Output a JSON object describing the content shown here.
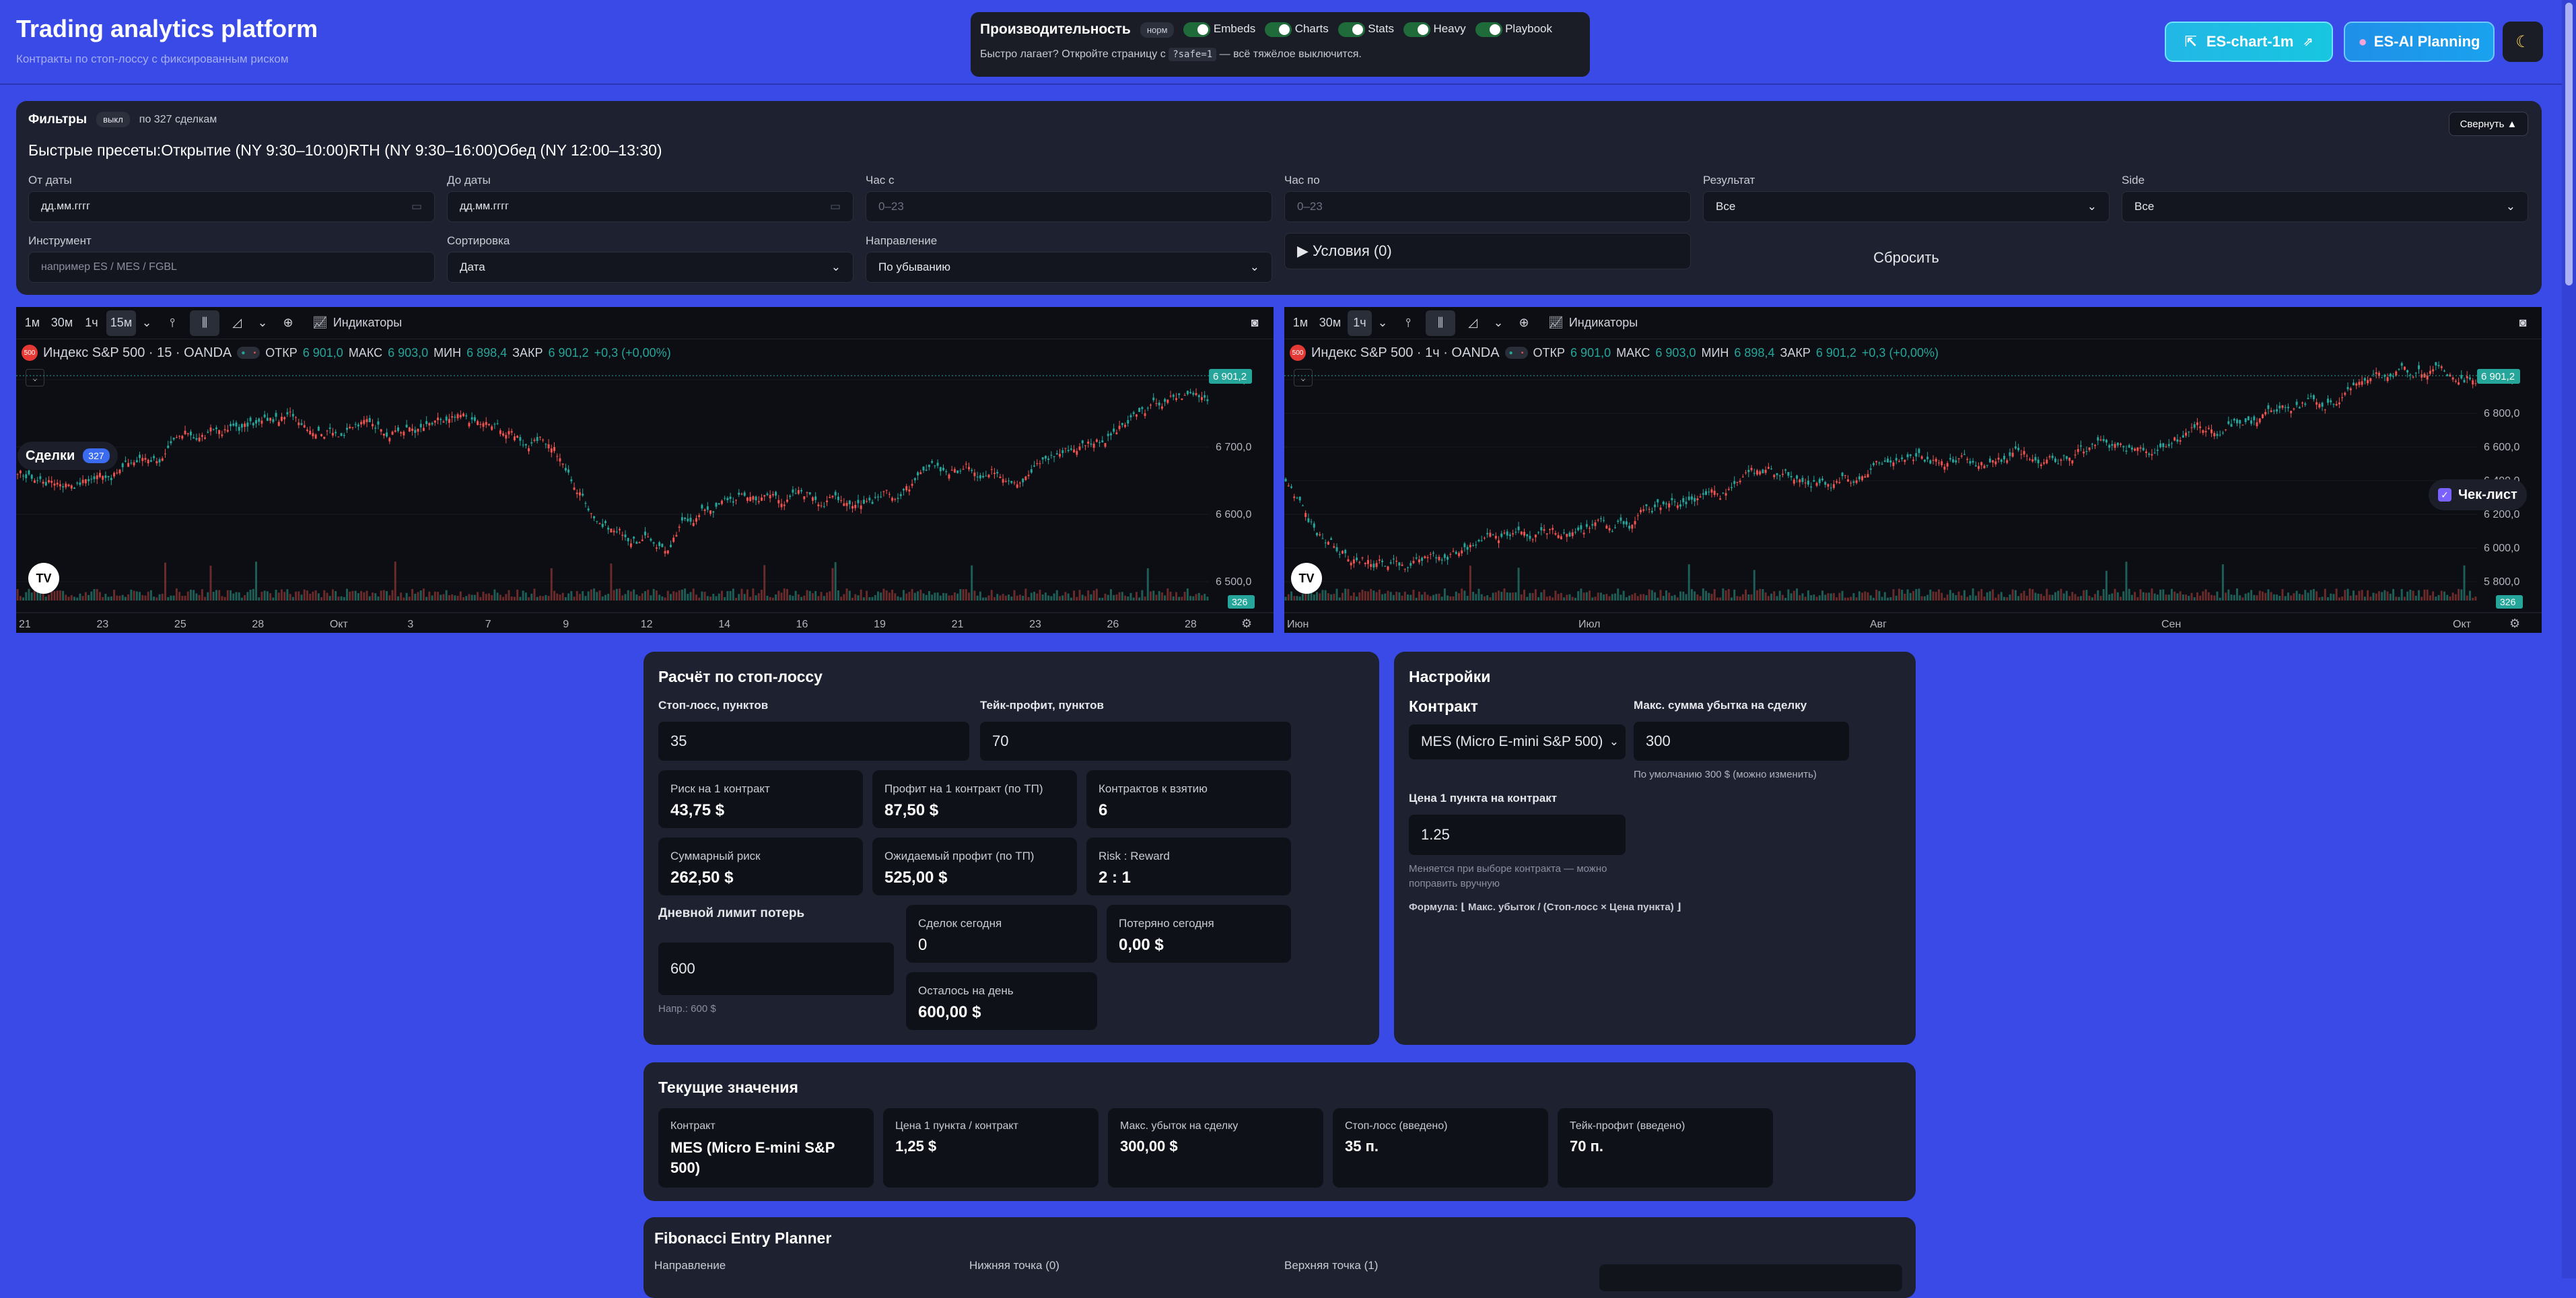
{
  "header": {
    "title": "Trading analytics platform",
    "subtitle": "Контракты по стоп-лоссу с фиксированным риском"
  },
  "perf": {
    "title": "Производительность",
    "mode_badge": "норм",
    "toggles": [
      "Embeds",
      "Charts",
      "Stats",
      "Heavy",
      "Playbook"
    ],
    "hint_pre": "Быстро лагает? Откройте страницу с",
    "hint_code": "?safe=1",
    "hint_post": "— всё тяжёлое выключится."
  },
  "top_buttons": {
    "chart": "ES-chart-1m",
    "planning": "ES-AI Planning",
    "theme_icon": "moon-icon"
  },
  "filters": {
    "title": "Фильтры",
    "badge": "выкл",
    "count": "по 327 сделкам",
    "collapse": "Свернуть ▲",
    "presets_label": "Быстрые пресеты:",
    "presets": [
      "Открытие (NY 9:30–10:00)",
      "RTH (NY 9:30–16:00)",
      "Обед (NY 12:00–13:30)"
    ],
    "from_label": "От даты",
    "from_value": "дд.мм.гггг",
    "to_label": "До даты",
    "to_value": "дд.мм.гггг",
    "hour_from_label": "Час с",
    "hour_from_placeholder": "0–23",
    "hour_to_label": "Час по",
    "hour_to_placeholder": "0–23",
    "result_label": "Результат",
    "result_value": "Все",
    "side_label": "Side",
    "side_value": "Все",
    "instrument_label": "Инструмент",
    "instrument_placeholder": "например ES / MES / FGBL",
    "sort_label": "Сортировка",
    "sort_value": "Дата",
    "direction_label": "Направление",
    "direction_value": "По убыванию",
    "conditions": "▶ Условия (0)",
    "reset": "Сбросить"
  },
  "chart_left": {
    "intervals": [
      "1м",
      "30м",
      "1ч",
      "15м"
    ],
    "active_interval": "15м",
    "indicators": "Индикаторы",
    "symbol": "Индекс S&P 500 · 15 · OANDA",
    "o_label": "ОТКР",
    "o": "6 901,0",
    "h_label": "МАКС",
    "h": "6 903,0",
    "l_label": "МИН",
    "l": "6 898,4",
    "c_label": "ЗАКР",
    "c": "6 901,2",
    "chg": "+0,3 (+0,00%)",
    "price_tag": "6 901,2",
    "vol_tag": "326",
    "trades_label": "Сделки",
    "trades_count": "327",
    "price_ticks": [
      "6 800,0",
      "6 700,0",
      "6 600,0",
      "6 500,0"
    ],
    "time_ticks": [
      "21",
      "23",
      "25",
      "28",
      "Окт",
      "3",
      "7",
      "9",
      "12",
      "14",
      "16",
      "19",
      "21",
      "23",
      "26",
      "28"
    ]
  },
  "chart_right": {
    "intervals": [
      "1м",
      "30м",
      "1ч"
    ],
    "active_interval": "1ч",
    "indicators": "Индикаторы",
    "symbol": "Индекс S&P 500 · 1ч · OANDA",
    "o_label": "ОТКР",
    "o": "6 901,0",
    "h_label": "МАКС",
    "h": "6 903,0",
    "l_label": "МИН",
    "l": "6 898,4",
    "c_label": "ЗАКР",
    "c": "6 901,2",
    "chg": "+0,3 (+0,00%)",
    "price_tag": "6 901,2",
    "vol_tag": "326",
    "checklist": "Чек-лист",
    "price_ticks": [
      "7 000,0",
      "6 800,0",
      "6 600,0",
      "6 400,0",
      "6 200,0",
      "6 000,0",
      "5 800,0"
    ],
    "time_ticks": [
      "Июн",
      "Июл",
      "Авг",
      "Сен",
      "Окт"
    ]
  },
  "calc": {
    "title": "Расчёт по стоп-лоссу",
    "sl_label": "Стоп-лосс, пунктов",
    "sl_value": "35",
    "tp_label": "Тейк-профит, пунктов",
    "tp_value": "70",
    "stats": [
      {
        "t": "Риск на 1 контракт",
        "v": "43,75 $"
      },
      {
        "t": "Профит на 1 контракт (по ТП)",
        "v": "87,50 $"
      },
      {
        "t": "Контрактов к взятию",
        "v": "6"
      },
      {
        "t": "Суммарный риск",
        "v": "262,50 $"
      },
      {
        "t": "Ожидаемый профит (по ТП)",
        "v": "525,00 $"
      },
      {
        "t": "Risk : Reward",
        "v": "2 : 1"
      }
    ],
    "daily_label": "Дневной лимит потерь",
    "daily_value": "600",
    "daily_hint": "Напр.: 600 $",
    "today": [
      {
        "t": "Сделок сегодня",
        "v": "0"
      },
      {
        "t": "Потеряно сегодня",
        "v": "0,00 $"
      },
      {
        "t": "Осталось на день",
        "v": "600,00 $"
      }
    ]
  },
  "settings": {
    "title": "Настройки",
    "contract_label": "Контракт",
    "contract_value": "MES (Micro E-mini S&P 500)",
    "maxloss_label": "Макс. сумма убытка на сделку",
    "maxloss_value": "300",
    "maxloss_hint": "По умолчанию 300 $ (можно изменить)",
    "point_label": "Цена 1 пункта на контракт",
    "point_value": "1.25",
    "point_hint": "Меняется при выборе контракта — можно поправить вручную",
    "formula": "Формула: ⌊ Макс. убыток / (Стоп-лосс × Цена пункта) ⌋"
  },
  "current": {
    "title": "Текущие значения",
    "items": [
      {
        "t": "Контракт",
        "v": "MES (Micro E-mini S&P 500)"
      },
      {
        "t": "Цена 1 пункта / контракт",
        "v": "1,25 $"
      },
      {
        "t": "Макс. убыток на сделку",
        "v": "300,00 $"
      },
      {
        "t": "Стоп-лосс (введено)",
        "v": "35 п."
      },
      {
        "t": "Тейк-профит (введено)",
        "v": "70 п."
      }
    ]
  },
  "fib": {
    "title": "Fibonacci Entry Planner",
    "direction": "Направление",
    "low": "Нижняя точка (0)",
    "high": "Верхняя точка (1)"
  },
  "colors": {
    "background": "#3a4ae6",
    "panel": "#1e2130",
    "up": "#26a69a",
    "down": "#ef5350",
    "accent": "#22d3ee"
  }
}
